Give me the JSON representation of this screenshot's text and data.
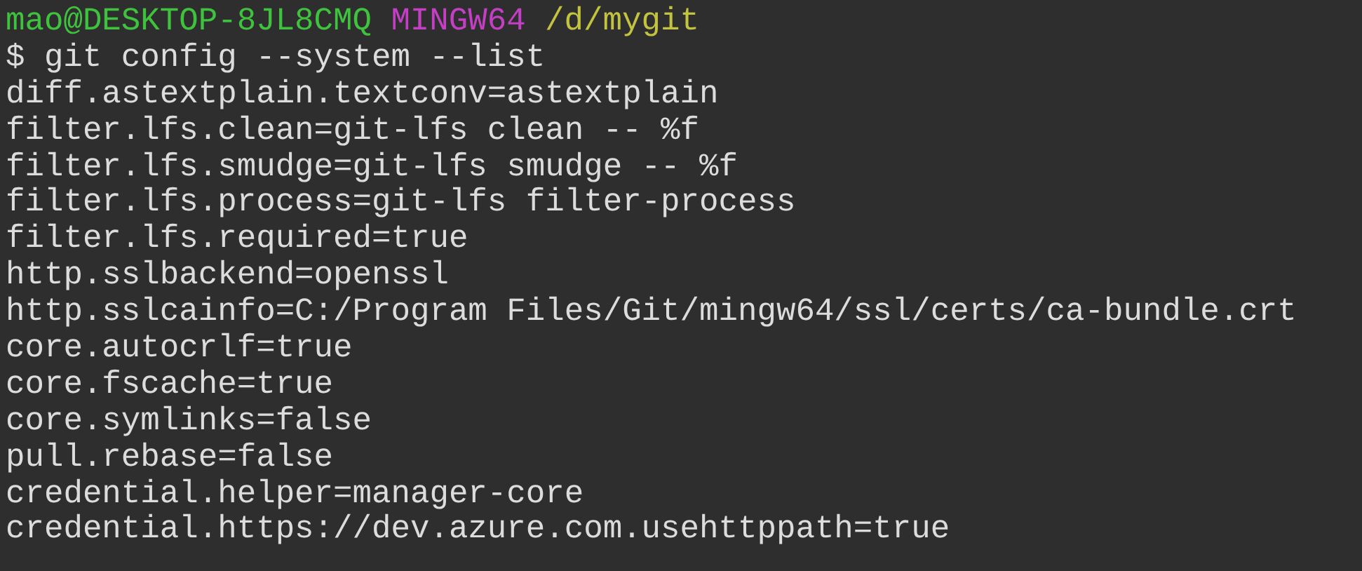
{
  "prompt": {
    "segments": [
      {
        "text": "mao@DESKTOP-8JL8CMQ",
        "color": "#3fc33f"
      },
      {
        "text": "MINGW64",
        "color": "#c33fc3"
      },
      {
        "text": "/d/mygit",
        "color": "#c3c33f"
      }
    ]
  },
  "command": {
    "symbol": "$",
    "text": "git config --system --list"
  },
  "output": [
    "diff.astextplain.textconv=astextplain",
    "filter.lfs.clean=git-lfs clean -- %f",
    "filter.lfs.smudge=git-lfs smudge -- %f",
    "filter.lfs.process=git-lfs filter-process",
    "filter.lfs.required=true",
    "http.sslbackend=openssl",
    "http.sslcainfo=C:/Program Files/Git/mingw64/ssl/certs/ca-bundle.crt",
    "core.autocrlf=true",
    "core.fscache=true",
    "core.symlinks=false",
    "pull.rebase=false",
    "credential.helper=manager-core",
    "credential.https://dev.azure.com.usehttppath=true"
  ]
}
